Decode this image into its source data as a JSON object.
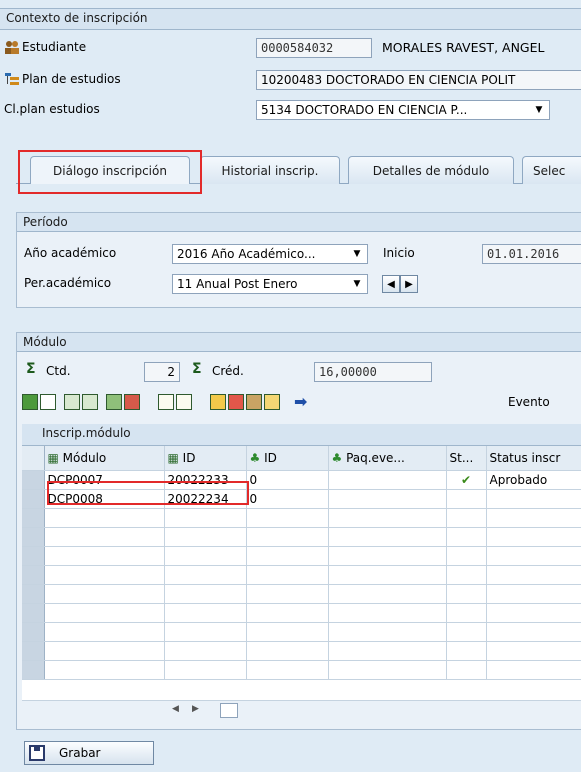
{
  "context": {
    "title": "Contexto de inscripción",
    "student_label": "Estudiante",
    "student_id": "0000584032",
    "student_name": "MORALES RAVEST, ANGEL",
    "plan_label": "Plan de estudios",
    "plan_value": "10200483 DOCTORADO EN CIENCIA POLIT",
    "clplan_label": "Cl.plan estudios",
    "clplan_value": "5134 DOCTORADO EN CIENCIA P..."
  },
  "tabs": [
    {
      "label": "Diálogo inscripción",
      "active": true
    },
    {
      "label": "Historial inscrip.",
      "active": false
    },
    {
      "label": "Detalles de módulo",
      "active": false
    },
    {
      "label": "Selec",
      "active": false
    }
  ],
  "periodo": {
    "title": "Período",
    "anio_label": "Año académico",
    "anio_value": "2016 Año Académico...",
    "inicio_label": "Inicio",
    "inicio_value": "01.01.2016",
    "per_label": "Per.académico",
    "per_value": "11 Anual Post Enero"
  },
  "modulo": {
    "title": "Módulo",
    "ctd_label": "Ctd.",
    "ctd_value": "2",
    "cred_label": "Créd.",
    "cred_value": "16,00000",
    "evento_label": "Evento",
    "table_title": "Inscrip.módulo",
    "columns": [
      "Módulo",
      "ID",
      "ID",
      "Paq.eve...",
      "St...",
      "Status inscr"
    ],
    "rows": [
      {
        "modulo": "DCP0007",
        "id": "20022233",
        "id2": "0",
        "paq": "",
        "status_icon": "check-icon",
        "status": "Aprobado"
      },
      {
        "modulo": "DCP0008",
        "id": "20022234",
        "id2": "0",
        "paq": "",
        "status_icon": "",
        "status": ""
      }
    ]
  },
  "footer": {
    "save_label": "Grabar"
  },
  "colors": {
    "highlight": "#e22a2a",
    "background": "#dfebf5"
  }
}
